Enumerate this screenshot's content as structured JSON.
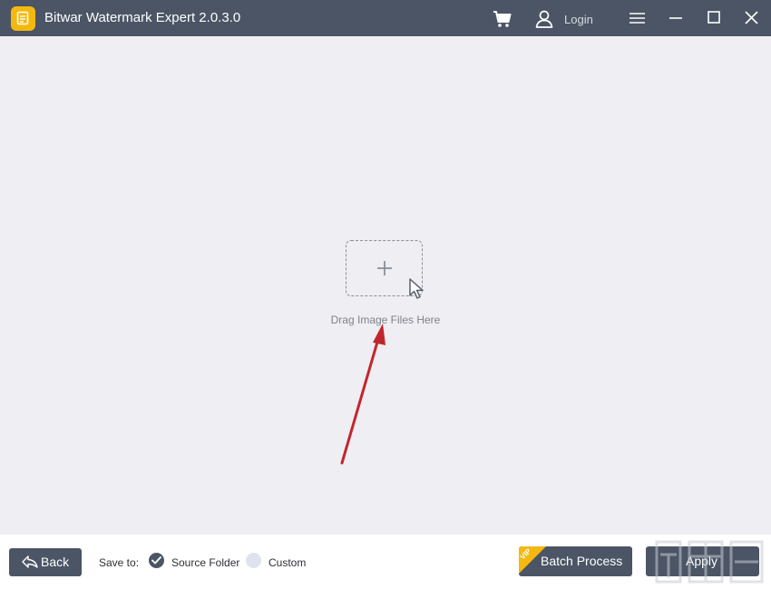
{
  "window": {
    "title": "Bitwar Watermark Expert  2.0.3.0",
    "login_label": "Login",
    "icons": [
      "app-logo-icon",
      "cart-icon",
      "user-icon",
      "menu-icon",
      "minimize-icon",
      "maximize-icon",
      "close-icon"
    ]
  },
  "drop_zone": {
    "label": "Drag Image Files Here",
    "icons": [
      "plus-icon",
      "cursor-icon"
    ]
  },
  "bottom_bar": {
    "back_label": "Back",
    "save_to_label": "Save to:",
    "save_options": [
      {
        "label": "Source Folder",
        "selected": true
      },
      {
        "label": "Custom",
        "selected": false
      }
    ],
    "batch_label": "Batch Process",
    "vip_badge": "VIP",
    "apply_label": "Apply"
  },
  "colors": {
    "titlebar": "#4b5565",
    "background": "#efeef2",
    "accent_logo": "#f5b80e",
    "annotation_arrow": "#c0272d"
  }
}
